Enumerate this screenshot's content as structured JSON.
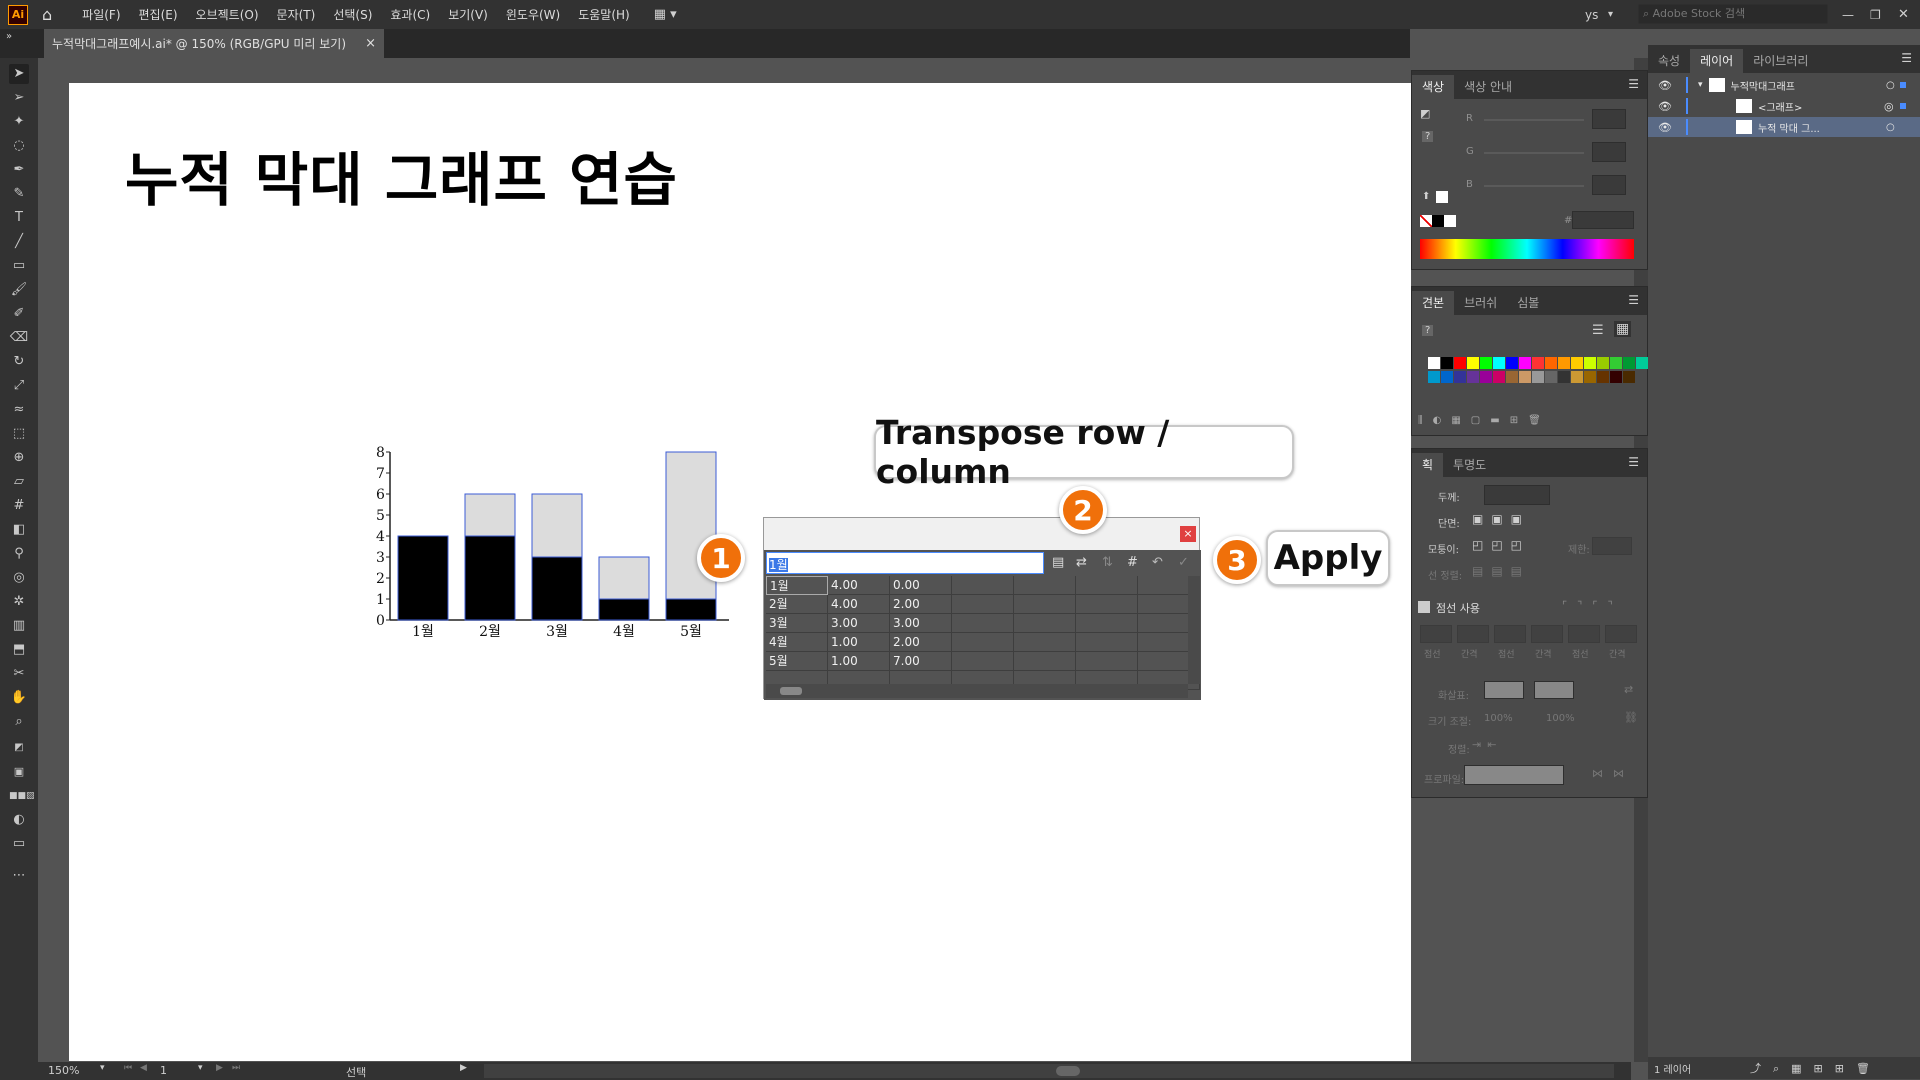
{
  "app": {
    "logo_text": "Ai",
    "user": "ys",
    "search_placeholder": "Adobe Stock 검색"
  },
  "menu": [
    "파일(F)",
    "편집(E)",
    "오브젝트(O)",
    "문자(T)",
    "선택(S)",
    "효과(C)",
    "보기(V)",
    "윈도우(W)",
    "도움말(H)"
  ],
  "document_tab": {
    "title": "누적막대그래프예시.ai* @ 150% (RGB/GPU 미리 보기)",
    "close": "×"
  },
  "artboard": {
    "heading": "누적 막대 그래프 연습"
  },
  "chart_data": {
    "type": "bar",
    "stacked": true,
    "categories": [
      "1월",
      "2월",
      "3월",
      "4월",
      "5월"
    ],
    "series": [
      {
        "values": [
          4,
          4,
          3,
          1,
          1
        ],
        "color": "#000000"
      },
      {
        "values": [
          0,
          2,
          3,
          2,
          7
        ],
        "color": "#dcdcdc"
      }
    ],
    "ylim": [
      0,
      8
    ],
    "yticks": [
      "0",
      "1",
      "2",
      "3",
      "4",
      "5",
      "6",
      "7",
      "8"
    ]
  },
  "graph_dialog": {
    "input_value": "1월",
    "close": "×",
    "rows": [
      [
        "1월",
        "4.00",
        "0.00"
      ],
      [
        "2월",
        "4.00",
        "2.00"
      ],
      [
        "3월",
        "3.00",
        "3.00"
      ],
      [
        "4월",
        "1.00",
        "2.00"
      ],
      [
        "5월",
        "1.00",
        "7.00"
      ]
    ]
  },
  "callouts": {
    "transpose": "Transpose row / column",
    "apply": "Apply",
    "badge1": "1",
    "badge2": "2",
    "badge3": "3"
  },
  "color_panel": {
    "tabs": [
      "색상",
      "색상 안내"
    ],
    "channels": [
      "R",
      "G",
      "B"
    ],
    "hash": "#"
  },
  "swatches_panel": {
    "tabs": [
      "견본",
      "브러쉬",
      "심볼"
    ]
  },
  "stroke_panel": {
    "tabs": [
      "획",
      "투명도"
    ],
    "weight_label": "두께:",
    "cap_label": "단면:",
    "corner_label": "모퉁이:",
    "limit_label": "제한:",
    "align_label": "선 정렬:",
    "dashed_label": "점선 사용",
    "dash_labels": [
      "점선",
      "간격",
      "점선",
      "간격",
      "점선",
      "간격"
    ],
    "arrow_label": "화살표:",
    "scale_label": "크기 조절:",
    "scale1": "100%",
    "scale2": "100%",
    "align2_label": "정렬:",
    "profile_label": "프로파일:"
  },
  "right_tabs": [
    "속성",
    "레이어",
    "라이브러리"
  ],
  "layers": [
    {
      "name": "누적막대그래프",
      "indent": 0
    },
    {
      "name": "<그래프>",
      "indent": 1
    },
    {
      "name": "누적 막대 그...",
      "indent": 1
    }
  ],
  "layers_footer": "1 레이어",
  "status": {
    "zoom": "150%",
    "page": "1",
    "mode": "선택"
  },
  "colors": {
    "accent": "#f0700a",
    "selection": "#4a8cff"
  }
}
